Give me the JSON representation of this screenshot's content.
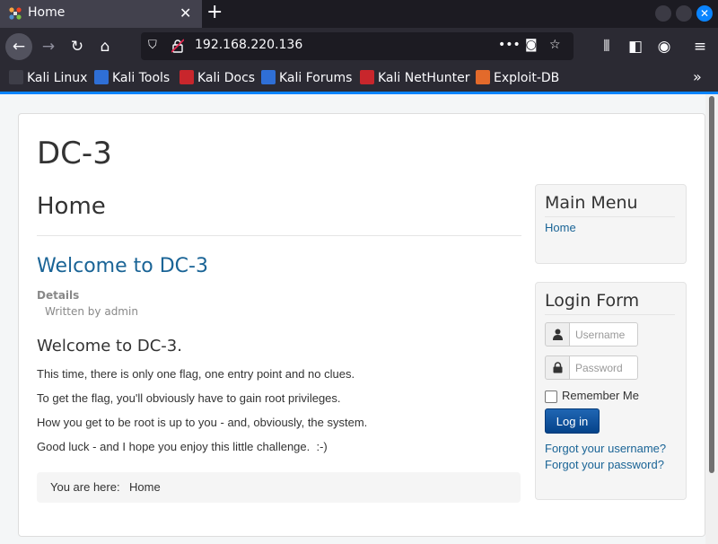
{
  "browser": {
    "tab_title": "Home",
    "url": "192.168.220.136",
    "bookmarks": [
      {
        "label": "Kali Linux",
        "color": "#3e3e48"
      },
      {
        "label": "Kali Tools",
        "color": "#2f6fd6"
      },
      {
        "label": "Kali Docs",
        "color": "#c8262c"
      },
      {
        "label": "Kali Forums",
        "color": "#2f6fd6"
      },
      {
        "label": "Kali NetHunter",
        "color": "#c8262c"
      },
      {
        "label": "Exploit-DB",
        "color": "#e36a2b"
      }
    ]
  },
  "page": {
    "site_title": "DC-3",
    "page_heading": "Home",
    "article": {
      "title": "Welcome to DC-3",
      "details_label": "Details",
      "author": "Written by admin",
      "heading": "Welcome to DC-3.",
      "paragraphs": [
        "This time, there is only one flag, one entry point and no clues.",
        "To get the flag, you'll obviously have to gain root privileges.",
        "How you get to be root is up to you - and, obviously, the system.",
        "Good luck - and I hope you enjoy this little challenge.  :-)"
      ]
    },
    "breadcrumb": {
      "label": "You are here:",
      "item": "Home"
    },
    "main_menu": {
      "title": "Main Menu",
      "items": [
        "Home"
      ]
    },
    "login_form": {
      "title": "Login Form",
      "username_placeholder": "Username",
      "password_placeholder": "Password",
      "remember_label": "Remember Me",
      "login_button": "Log in",
      "forgot_username": "Forgot your username?",
      "forgot_password": "Forgot your password?"
    }
  },
  "colors": {
    "link": "#1a6496",
    "accent": "#0a84ff",
    "login_button": "#0a4f94"
  }
}
